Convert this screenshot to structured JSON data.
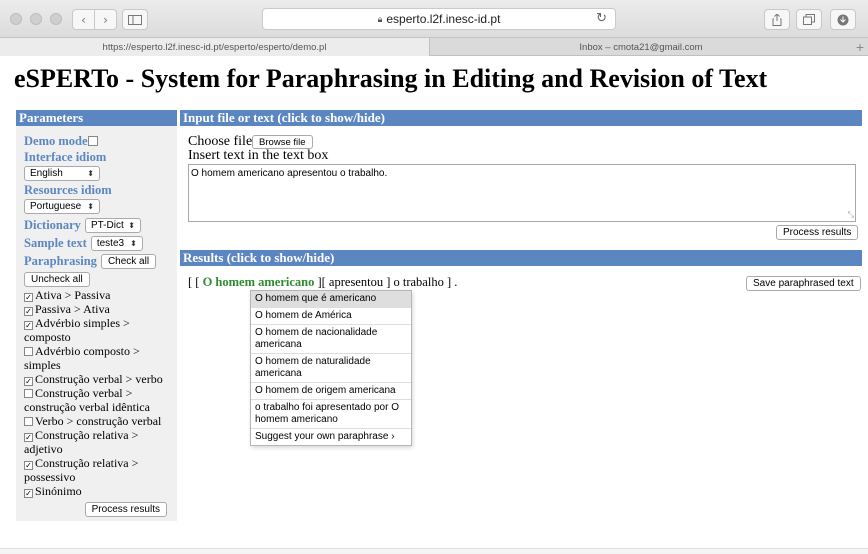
{
  "browser": {
    "address": "esperto.l2f.inesc-id.pt",
    "tabs": [
      {
        "label": "https://esperto.l2f.inesc-id.pt/esperto/esperto/demo.pl"
      },
      {
        "label": "Inbox – cmota21@gmail.com"
      }
    ],
    "icons": [
      "close-traffic-icon",
      "back-icon",
      "forward-icon",
      "sidebar-icon",
      "lock-icon",
      "reload-icon",
      "share-icon",
      "tabs-icon",
      "download-icon",
      "new-tab-icon"
    ]
  },
  "page": {
    "title": "eSPERTo - System for Paraphrasing in Editing and Revision of Text"
  },
  "params": {
    "header": "Parameters",
    "demo_mode_label": "Demo mode",
    "interface_idiom_label": "Interface idiom",
    "interface_idiom_value": "English",
    "resources_idiom_label": "Resources idiom",
    "resources_idiom_value": "Portuguese",
    "dictionary_label": "Dictionary",
    "dictionary_value": "PT-Dict",
    "sample_text_label": "Sample text",
    "sample_text_value": "teste3",
    "paraphrasing_label": "Paraphrasing",
    "check_all_label": "Check all",
    "uncheck_all_label": "Uncheck all",
    "options": [
      {
        "label": "Ativa > Passiva",
        "checked": true
      },
      {
        "label": "Passiva > Ativa",
        "checked": true
      },
      {
        "label": "Advérbio simples > composto",
        "checked": true
      },
      {
        "label": "Advérbio composto > simples",
        "checked": false
      },
      {
        "label": "Construção verbal > verbo",
        "checked": true
      },
      {
        "label": "Construção verbal > construção verbal idêntica",
        "checked": false
      },
      {
        "label": "Verbo > construção verbal",
        "checked": false
      },
      {
        "label": "Construção relativa > adjetivo",
        "checked": true
      },
      {
        "label": "Construção relativa > possessivo",
        "checked": true
      },
      {
        "label": "Sinónimo",
        "checked": true
      }
    ],
    "process_label": "Process results"
  },
  "input": {
    "header": "Input file or text (click to show/hide)",
    "choose_file_label": "Choose file: ",
    "browse_label": "Browse file",
    "insert_label": "Insert text in the text box",
    "text_value": "O homem americano apresentou o trabalho.",
    "process_label": "Process results"
  },
  "results": {
    "header": "Results (click to show/hide)",
    "open_outer": "[ [",
    "highlight": "O homem americano",
    "after_highlight": "][ apresentou ] o trabalho ] .",
    "save_label": "Save paraphrased text",
    "suggestions": [
      "O homem que é americano",
      "O homem de América",
      "O homem de nacionalidade americana",
      "O homem de naturalidade americana",
      "O homem de origem americana",
      "o trabalho foi apresentado por O homem americano",
      "Suggest your own paraphrase ›"
    ]
  }
}
